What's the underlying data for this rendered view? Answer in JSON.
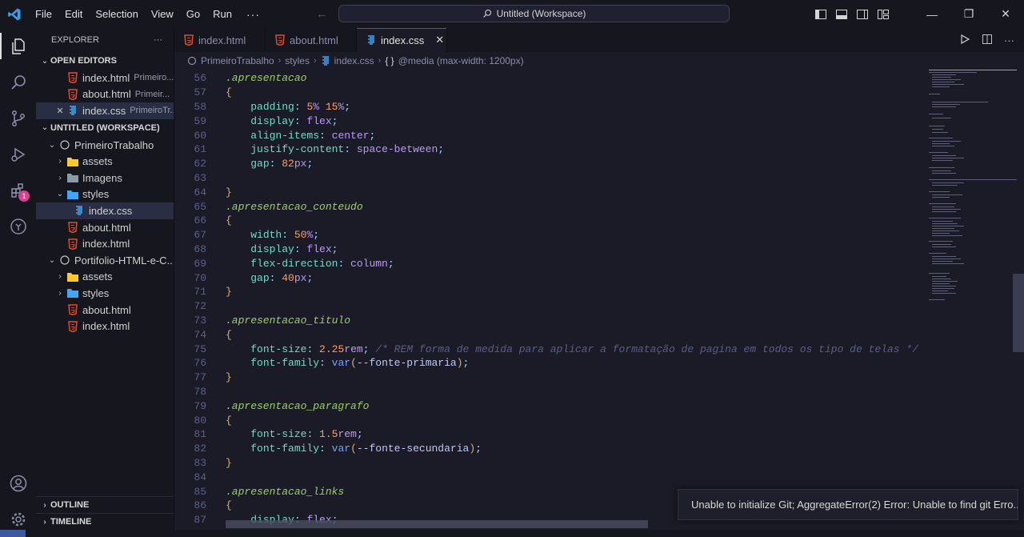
{
  "menu": [
    "File",
    "Edit",
    "Selection",
    "View",
    "Go",
    "Run"
  ],
  "menu_more": "···",
  "command_center": "Untitled (Workspace)",
  "explorer": {
    "title": "EXPLORER",
    "more": "···",
    "open_editors_label": "OPEN EDITORS",
    "open_editors": [
      {
        "name": "index.html",
        "desc": "Primeiro..."
      },
      {
        "name": "about.html",
        "desc": "Primeir..."
      },
      {
        "name": "index.css",
        "desc": "PrimeiroTr..."
      }
    ],
    "workspace_label": "UNTITLED (WORKSPACE)",
    "tree": [
      {
        "name": "PrimeiroTrabalho"
      },
      {
        "name": "assets"
      },
      {
        "name": "Imagens"
      },
      {
        "name": "styles"
      },
      {
        "name": "index.css"
      },
      {
        "name": "about.html"
      },
      {
        "name": "index.html"
      },
      {
        "name": "Portifolio-HTML-e-C..."
      },
      {
        "name": "assets"
      },
      {
        "name": "styles"
      },
      {
        "name": "about.html"
      },
      {
        "name": "index.html"
      }
    ],
    "outline_label": "OUTLINE",
    "timeline_label": "TIMELINE"
  },
  "activity": {
    "extensions_badge": "1"
  },
  "tabs": [
    {
      "label": "index.html"
    },
    {
      "label": "about.html"
    },
    {
      "label": "index.css",
      "close": "✕"
    }
  ],
  "breadcrumb": {
    "project": "PrimeiroTrabalho",
    "folder": "styles",
    "file": "index.css",
    "symbol_glyph": "{ }",
    "symbol": "@media (max-width: 1200px)"
  },
  "editor": {
    "lines": [
      {
        "n": "56"
      },
      {
        "n": "57"
      },
      {
        "n": "58"
      },
      {
        "n": "59"
      },
      {
        "n": "60"
      },
      {
        "n": "61"
      },
      {
        "n": "62"
      },
      {
        "n": "63"
      },
      {
        "n": "64"
      },
      {
        "n": "65"
      },
      {
        "n": "66"
      },
      {
        "n": "67"
      },
      {
        "n": "68"
      },
      {
        "n": "69"
      },
      {
        "n": "70"
      },
      {
        "n": "71"
      },
      {
        "n": "72"
      },
      {
        "n": "73"
      },
      {
        "n": "74"
      },
      {
        "n": "75"
      },
      {
        "n": "76"
      },
      {
        "n": "77"
      },
      {
        "n": "78"
      },
      {
        "n": "79"
      },
      {
        "n": "80"
      },
      {
        "n": "81"
      },
      {
        "n": "82"
      },
      {
        "n": "83"
      },
      {
        "n": "84"
      },
      {
        "n": "85"
      },
      {
        "n": "86"
      },
      {
        "n": "87"
      }
    ],
    "code": {
      "sel_apresentacao": ".apresentacao",
      "sel_conteudo": ".apresentacao_conteudo",
      "sel_titulo": ".apresentacao_titulo",
      "sel_paragrafo": ".apresentacao_paragrafo",
      "sel_links": ".apresentacao_links",
      "open": "{",
      "close": "}",
      "padding": "padding",
      "padding_v1": "5",
      "padding_v2": "15",
      "display": "display",
      "flex": "flex",
      "align_items": "align-items",
      "center": "center",
      "justify_content": "justify-content",
      "space_between": "space-between",
      "gap": "gap",
      "gap_v1": "82",
      "width": "width",
      "width_v": "50",
      "flex_direction": "flex-direction",
      "column": "column",
      "gap_v2": "40",
      "font_size": "font-size",
      "fs_v1": "2.25",
      "fs_v2": "1.5",
      "rem": "rem",
      "px": "px",
      "pct": "%",
      "comment": "/* REM forma de medida para aplicar a formatação de pagina em todos os tipo de telas */",
      "font_family": "font-family",
      "var": "var",
      "fonte_primaria": "--fonte-primaria",
      "fonte_secundaria": "--fonte-secundaria"
    }
  },
  "notification": {
    "message": "Unable to initialize Git; AggregateError(2) Error: Unable to find git Erro..."
  },
  "colors": {
    "accent": "#3d59a1",
    "badge": "#d6408c",
    "html_icon": "#e34c26",
    "css_icon": "#42a5f5",
    "folder": "#ffca28",
    "error": "#f14c4c"
  }
}
